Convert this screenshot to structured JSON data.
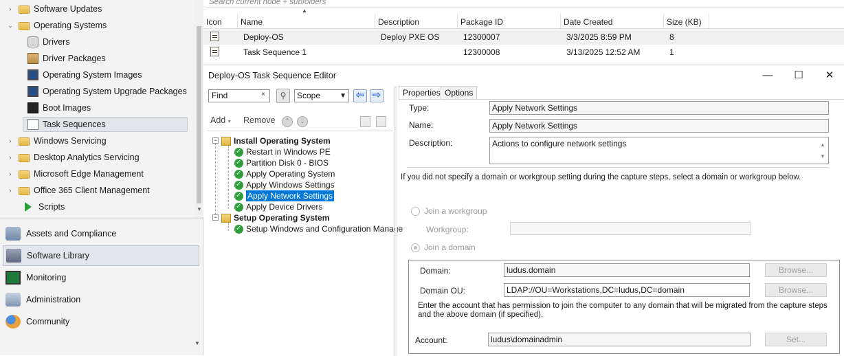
{
  "nav_tree": {
    "items": [
      {
        "label": "Software Updates",
        "icon": "folder-icon",
        "expander": "›"
      },
      {
        "label": "Operating Systems",
        "icon": "folder-icon",
        "expander": "⌄"
      },
      {
        "label": "Drivers",
        "icon": "driver-icon"
      },
      {
        "label": "Driver Packages",
        "icon": "driver-package-icon"
      },
      {
        "label": "Operating System Images",
        "icon": "os-image-icon"
      },
      {
        "label": "Operating System Upgrade Packages",
        "icon": "os-upgrade-package-icon"
      },
      {
        "label": "Boot Images",
        "icon": "boot-image-icon"
      },
      {
        "label": "Task Sequences",
        "icon": "task-sequence-icon",
        "selected": true
      },
      {
        "label": "Windows Servicing",
        "icon": "folder-icon",
        "expander": "›"
      },
      {
        "label": "Desktop Analytics Servicing",
        "icon": "folder-icon",
        "expander": "›"
      },
      {
        "label": "Microsoft Edge Management",
        "icon": "folder-icon",
        "expander": "›"
      },
      {
        "label": "Office 365 Client Management",
        "icon": "folder-icon",
        "expander": "›"
      },
      {
        "label": "Scripts",
        "icon": "script-icon"
      }
    ]
  },
  "workspaces": [
    {
      "label": "Assets and Compliance",
      "icon": "assets-icon"
    },
    {
      "label": "Software Library",
      "icon": "software-library-icon",
      "selected": true
    },
    {
      "label": "Monitoring",
      "icon": "monitoring-icon"
    },
    {
      "label": "Administration",
      "icon": "administration-icon"
    },
    {
      "label": "Community",
      "icon": "community-icon"
    }
  ],
  "list": {
    "search_placeholder": "Search current node + subfolders",
    "columns": [
      "Icon",
      "Name",
      "Description",
      "Package ID",
      "Date Created",
      "Size (KB)"
    ],
    "rows": [
      {
        "name": "Deploy-OS",
        "description": "Deploy PXE OS",
        "package_id": "12300007",
        "date_created": "3/3/2025 8:59 PM",
        "size_kb": "8"
      },
      {
        "name": "Task Sequence 1",
        "description": "",
        "package_id": "12300008",
        "date_created": "3/13/2025 12:52 AM",
        "size_kb": "1"
      }
    ]
  },
  "editor": {
    "title": "Deploy-OS Task Sequence Editor",
    "window_buttons": {
      "minimize": "—",
      "maximize": "☐",
      "close": "✕"
    },
    "find_value": "Find",
    "find_clear": "×",
    "scope_value": "Scope",
    "toolbar": {
      "add": "Add",
      "add_caret": "▾",
      "remove": "Remove"
    },
    "tree": {
      "groups": [
        {
          "label": "Install Operating System",
          "steps": [
            "Restart in Windows PE",
            "Partition Disk 0 - BIOS",
            "Apply Operating System",
            "Apply Windows Settings",
            "Apply Network Settings",
            "Apply Device Drivers"
          ]
        },
        {
          "label": "Setup Operating System",
          "steps": [
            "Setup Windows and Configuration Manage"
          ]
        }
      ],
      "selected_step": "Apply Network Settings"
    },
    "tabs": [
      "Properties",
      "Options"
    ],
    "properties": {
      "type_label": "Type:",
      "type_value": "Apply Network Settings",
      "name_label": "Name:",
      "name_value": "Apply Network Settings",
      "description_label": "Description:",
      "description_value": "Actions to configure network settings",
      "instructions": "If you did not specify a domain or workgroup setting during the capture steps, select a domain or workgroup below.",
      "join_workgroup_label": "Join a workgroup",
      "workgroup_label": "Workgroup:",
      "workgroup_value": "",
      "join_domain_label": "Join a domain",
      "domain_label": "Domain:",
      "domain_value": "ludus.domain",
      "domain_ou_label": "Domain OU:",
      "domain_ou_value": "LDAP://OU=Workstations,DC=ludus,DC=domain",
      "browse_label": "Browse...",
      "account_note": "Enter the account that has permission to join the computer to any domain that will be migrated from the capture steps and the above domain (if specified).",
      "account_label": "Account:",
      "account_value": "ludus\\domainadmin",
      "set_label": "Set..."
    }
  },
  "colors": {
    "selection_blue": "#0078d7",
    "step_ok_green": "#2e9e3a",
    "nav_selected": "#e2e5ea"
  }
}
